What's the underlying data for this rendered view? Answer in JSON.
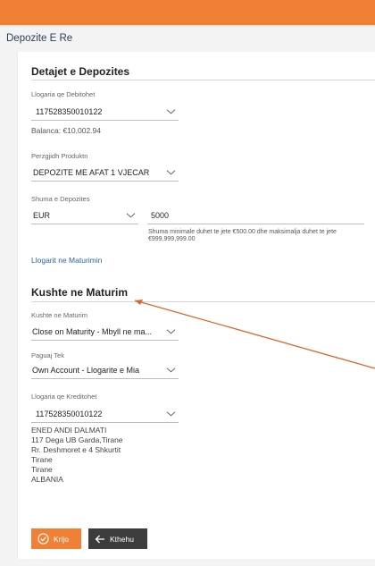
{
  "header": {
    "title": "Depozite E Re"
  },
  "details": {
    "title": "Detajet e Depozites",
    "debit_account": {
      "label": "Llogaria qe Debitohet",
      "value": "117528350010122",
      "icon": "chevron-down-icon"
    },
    "balance": "Balanca: €10,002.94",
    "product": {
      "label": "Perzgjidh Produktn",
      "value": "DEPOZITE ME AFAT 1 VJECAR",
      "icon": "chevron-down-icon"
    },
    "amount": {
      "label": "Shuma e Depozites",
      "currency": "EUR",
      "value": "5000",
      "hint": "Shuma minimale duhet te jete €500.00 dhe maksimalja duhet te jete €999,999,999.00"
    },
    "maturity_link": "Llogarit ne Maturimin"
  },
  "maturity": {
    "title": "Kushte ne Maturim",
    "condition": {
      "label": "Kushte ne Maturim",
      "value": "Close on Maturity - Mbyll ne ma..."
    },
    "pay_to": {
      "label": "Paguaj Tek",
      "value": "Own Account - Llogarite e Mia"
    },
    "credit_account": {
      "label": "Llogaria qe Kreditohet",
      "value": "117528350010122"
    },
    "address": [
      "ENED ANDI DALMATI",
      "117 Dega UB Garda,Tirane",
      "Rr. Deshmoret e 4 Shkurtit",
      "Tirane",
      "Tirane",
      "ALBANIA"
    ]
  },
  "actions": {
    "create_label": "Krijo",
    "create_icon": "check-circle-icon",
    "back_label": "Kthehu",
    "back_icon": "arrow-left-icon"
  },
  "colors": {
    "accent": "#f08035",
    "dark_button": "#3c3c3c",
    "link": "#2a63a8",
    "annotation_arrow": "#d9662a"
  }
}
